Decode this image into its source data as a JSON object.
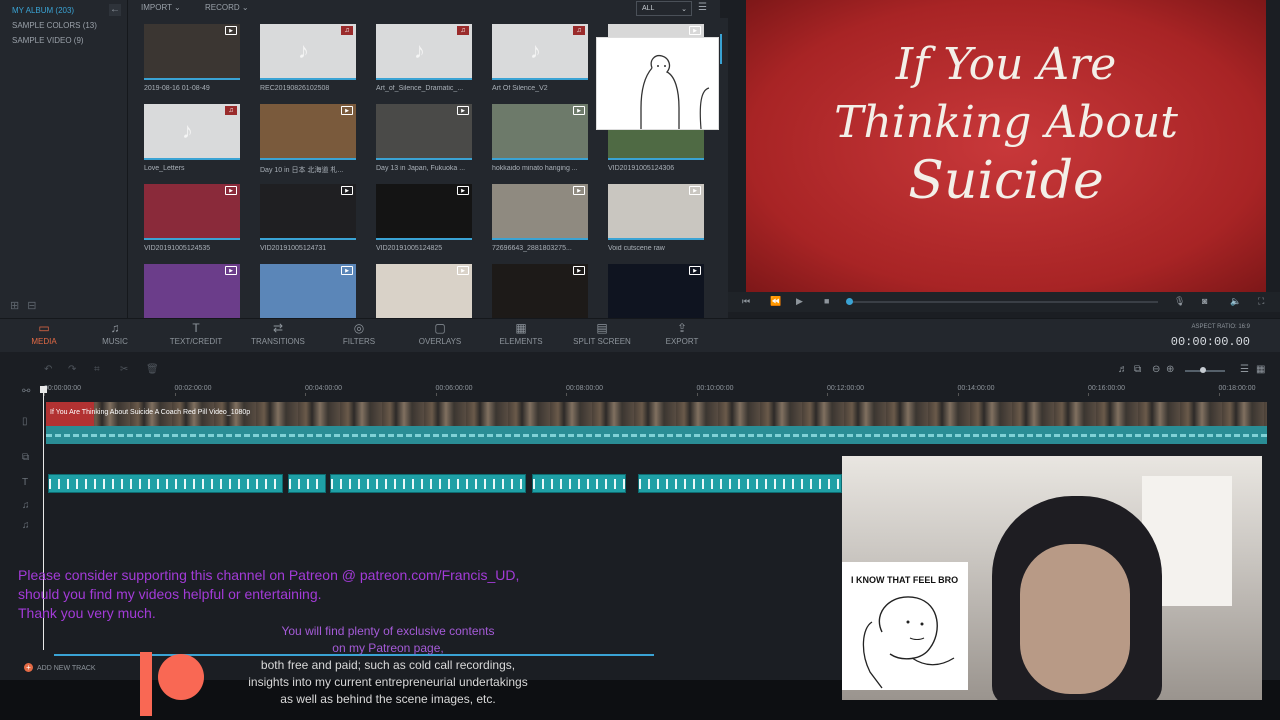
{
  "sidebar": {
    "items": [
      {
        "label": "MY ALBUM (203)",
        "active": true
      },
      {
        "label": "SAMPLE COLORS (13)"
      },
      {
        "label": "SAMPLE VIDEO (9)"
      }
    ],
    "collapse_icon": "arrow-left-icon"
  },
  "media_toolbar": {
    "import_label": "IMPORT",
    "record_label": "RECORD",
    "filter_value": "ALL"
  },
  "media": [
    {
      "name": "2019-08-16 01-08-49",
      "kind": "video",
      "thumb": "#3b3632"
    },
    {
      "name": "REC20190826102508",
      "kind": "audio"
    },
    {
      "name": "Art_of_Silence_Dramatic_...",
      "kind": "audio"
    },
    {
      "name": "Art Of Silence_V2",
      "kind": "audio"
    },
    {
      "name": "",
      "kind": "video",
      "thumb": "#d8d8d8"
    },
    {
      "name": "Love_Letters",
      "kind": "audio"
    },
    {
      "name": "Day 10 in 日本 北海道 札...",
      "kind": "video",
      "thumb": "#7a5a3c"
    },
    {
      "name": "Day 13 in Japan, Fukuoka ...",
      "kind": "video",
      "thumb": "#4a4a48"
    },
    {
      "name": "hokkaido minato hanging ...",
      "kind": "video",
      "thumb": "#6d7a6a"
    },
    {
      "name": "VID20191005124306",
      "kind": "video",
      "thumb": "#4f6a44"
    },
    {
      "name": "VID20191005124535",
      "kind": "video",
      "thumb": "#8a2a3a"
    },
    {
      "name": "VID20191005124731",
      "kind": "video",
      "thumb": "#1f1f22"
    },
    {
      "name": "VID20191005124825",
      "kind": "video",
      "thumb": "#141414"
    },
    {
      "name": "72696643_2881803275...",
      "kind": "video",
      "thumb": "#8f8a80"
    },
    {
      "name": "Void cutscene raw",
      "kind": "video",
      "thumb": "#c9c6c0"
    },
    {
      "name": "",
      "kind": "video",
      "thumb": "#6b3d8a"
    },
    {
      "name": "",
      "kind": "video",
      "thumb": "#5b86b8"
    },
    {
      "name": "",
      "kind": "video",
      "thumb": "#d9d2c8"
    },
    {
      "name": "",
      "kind": "video",
      "thumb": "#1d1a18"
    },
    {
      "name": "",
      "kind": "video",
      "thumb": "#0f1420"
    }
  ],
  "preview": {
    "title_lines": [
      "If You Are",
      "Thinking About",
      "Suicide"
    ],
    "progress": 0
  },
  "main_toolbar": {
    "tabs": [
      {
        "label": "MEDIA",
        "icon": "folder-icon",
        "glyph": "▭",
        "active": true
      },
      {
        "label": "MUSIC",
        "icon": "music-note-icon",
        "glyph": "♫"
      },
      {
        "label": "TEXT/CREDIT",
        "icon": "text-icon",
        "glyph": "T"
      },
      {
        "label": "TRANSITIONS",
        "icon": "transitions-icon",
        "glyph": "⇄"
      },
      {
        "label": "FILTERS",
        "icon": "filters-icon",
        "glyph": "◎"
      },
      {
        "label": "OVERLAYS",
        "icon": "overlays-icon",
        "glyph": "▢"
      },
      {
        "label": "ELEMENTS",
        "icon": "elements-icon",
        "glyph": "▦"
      },
      {
        "label": "SPLIT SCREEN",
        "icon": "split-screen-icon",
        "glyph": "▤"
      },
      {
        "label": "EXPORT",
        "icon": "export-icon",
        "glyph": "⇪"
      }
    ],
    "aspect_ratio": "ASPECT RATIO: 16:9",
    "timecode": "00:00:00.00"
  },
  "timeline": {
    "ticks": [
      "00:00:00:00",
      "00:02:00:00",
      "00:04:00:00",
      "00:06:00:00",
      "00:08:00:00",
      "00:10:00:00",
      "00:12:00:00",
      "00:14:00:00",
      "00:16:00:00",
      "00:18:00:00"
    ],
    "clip_label": "If You Are Thinking About Suicide  A Coach Red Pill Video_1080p",
    "add_track_label": "ADD NEW TRACK",
    "zoom_level": 0.4
  },
  "overlay_text": {
    "patreon_lines": [
      "Please consider supporting this channel on Patreon @ patreon.com/Francis_UD,",
      "should you find my videos helpful or entertaining.",
      "Thank you very much."
    ],
    "sub_purple_lines": [
      "You will find plenty of exclusive contents",
      "on my Patreon page,"
    ],
    "sub_white_lines": [
      "both free and paid; such as cold call recordings,",
      "insights into my current entrepreneurial undertakings",
      "as well as behind the scene images, etc."
    ]
  },
  "webcam": {
    "meme_caption": "I KNOW THAT FEEL BRO"
  }
}
